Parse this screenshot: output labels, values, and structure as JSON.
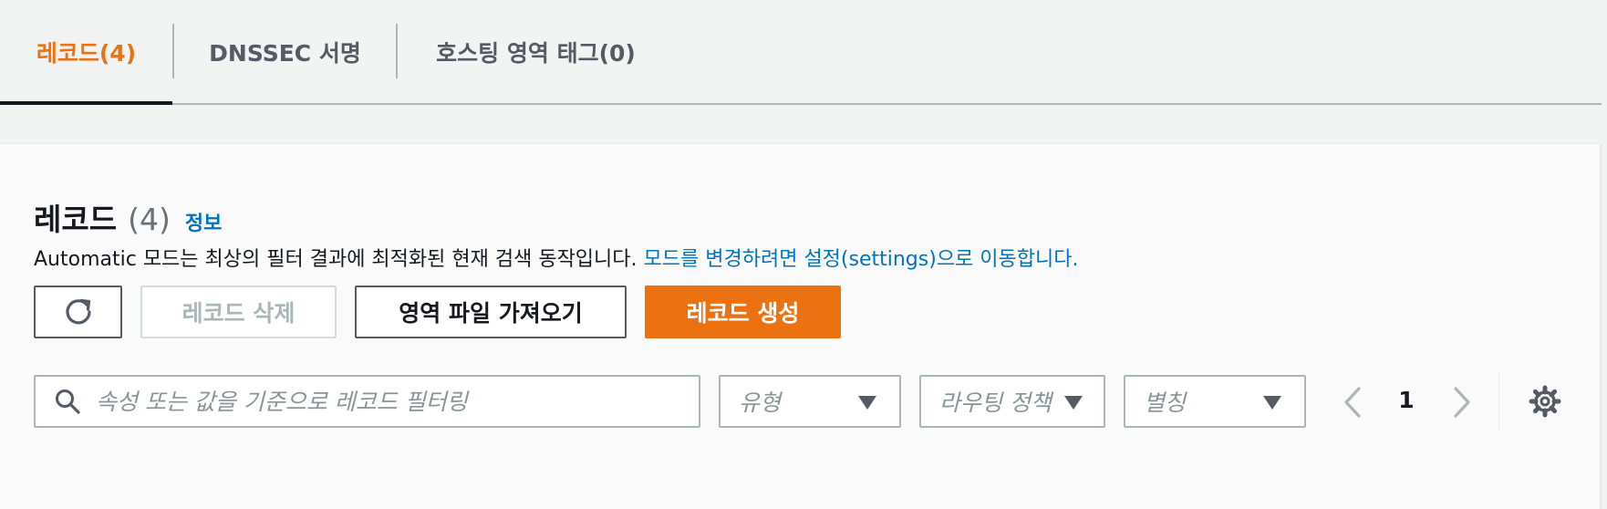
{
  "tabs": [
    {
      "label": "레코드(4)",
      "active": true
    },
    {
      "label": "DNSSEC 서명",
      "active": false
    },
    {
      "label": "호스팅 영역 태그(0)",
      "active": false
    }
  ],
  "panel": {
    "title": "레코드",
    "count": "(4)",
    "info_link": "정보",
    "description": "Automatic 모드는 최상의 필터 결과에 최적화된 현재 검색 동작입니다. ",
    "description_link": "모드를 변경하려면 설정(settings)으로 이동합니다."
  },
  "buttons": {
    "refresh_icon": "refresh-icon",
    "delete": "레코드 삭제",
    "import": "영역 파일 가져오기",
    "create": "레코드 생성"
  },
  "filters": {
    "search_placeholder": "속성 또는 값을 기준으로 레코드 필터링",
    "type_placeholder": "유형",
    "routing_placeholder": "라우팅 정책",
    "alias_placeholder": "별칭"
  },
  "pagination": {
    "current_page": "1"
  },
  "colors": {
    "accent": "#ec7211",
    "link": "#0073bb",
    "text": "#16191f",
    "muted": "#879596",
    "border": "#aab7b8",
    "background": "#f2f3f3"
  }
}
